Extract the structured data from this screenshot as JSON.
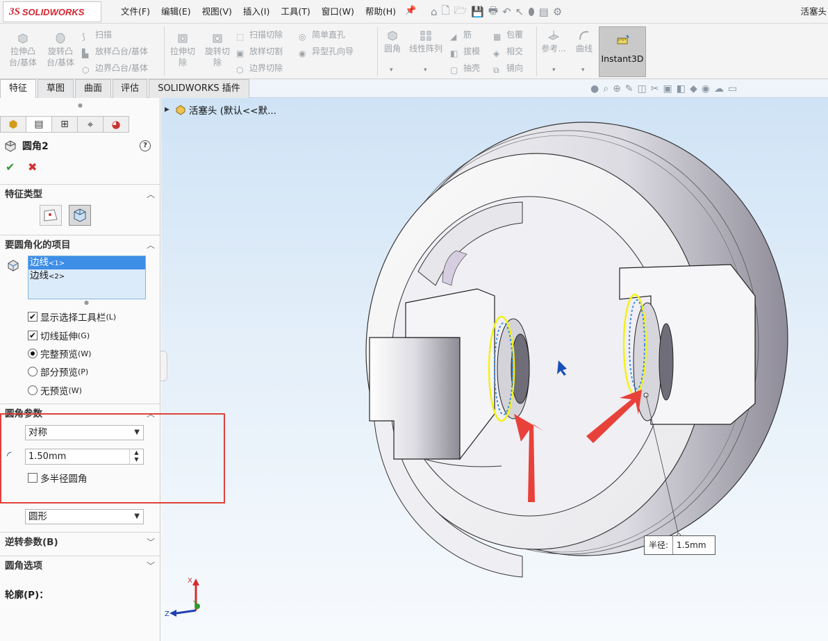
{
  "app": {
    "logo_prefix": "3S",
    "logo_name": "SOLIDWORKS",
    "document": "活塞头"
  },
  "menu": [
    "文件(F)",
    "编辑(E)",
    "视图(V)",
    "插入(I)",
    "工具(T)",
    "窗口(W)",
    "帮助(H)"
  ],
  "ribbon": {
    "extrude_boss": [
      "拉伸凸",
      "台/基体"
    ],
    "revolve_boss": [
      "旋转凸",
      "台/基体"
    ],
    "sweep": "扫描",
    "loft_boss": "放样凸台/基体",
    "boundary_boss": "边界凸台/基体",
    "extrude_cut": [
      "拉伸切",
      "除"
    ],
    "revolve_cut": [
      "旋转切",
      "除"
    ],
    "sweep_cut": "扫描切除",
    "loft_cut": "放样切割",
    "boundary_cut": "边界切除",
    "simple_hole": "简单直孔",
    "hole_wizard": "异型孔向导",
    "fillet": "圆角",
    "linear_pattern": "线性阵列",
    "rib": "筋",
    "draft": "拔模",
    "shell": "抽壳",
    "wrap": "包覆",
    "intersect": "相交",
    "mirror": "镜向",
    "reference": "参考...",
    "curves": "曲线",
    "instant3d": "Instant3D"
  },
  "tabs": [
    "特征",
    "草图",
    "曲面",
    "评估",
    "SOLIDWORKS 插件"
  ],
  "tree_item": "活塞头 (默认<<默...",
  "panel": {
    "feature_name": "圆角2",
    "help_glyph": "?",
    "ok_glyph": "✔",
    "cancel_glyph": "✖",
    "sections": {
      "feature_type": "特征类型",
      "items": "要圆角化的项目",
      "params": "圆角参数",
      "reverse": "逆转参数(B)",
      "options": "圆角选项"
    },
    "items": [
      {
        "name": "边线",
        "index": "<1>"
      },
      {
        "name": "边线",
        "index": "<2>"
      }
    ],
    "options": {
      "show_toolbar": {
        "label": "显示选择工具栏",
        "hotkey": "(L)",
        "checked": true
      },
      "tangent": {
        "label": "切线延伸",
        "hotkey": "(G)",
        "checked": true
      },
      "full_preview": {
        "label": "完整预览",
        "hotkey": "(W)",
        "selected": true
      },
      "partial_preview": {
        "label": "部分预览",
        "hotkey": "(P)",
        "selected": false
      },
      "no_preview": {
        "label": "无预览",
        "hotkey": "(W)",
        "selected": false
      }
    },
    "method": "对称",
    "radius": "1.50mm",
    "multi_radius": {
      "label": "多半径圆角",
      "checked": false
    },
    "profile_label": "轮廓(P)：",
    "profile": "圆形"
  },
  "callout": {
    "label": "半径:",
    "value": "1.5mm"
  },
  "triad": {
    "x": "X",
    "y": "Y",
    "z": "Z"
  },
  "colors": {
    "accent_red": "#e0403a",
    "selection_yellow": "#f2f21a",
    "selection_blue": "#3d8ee6"
  }
}
